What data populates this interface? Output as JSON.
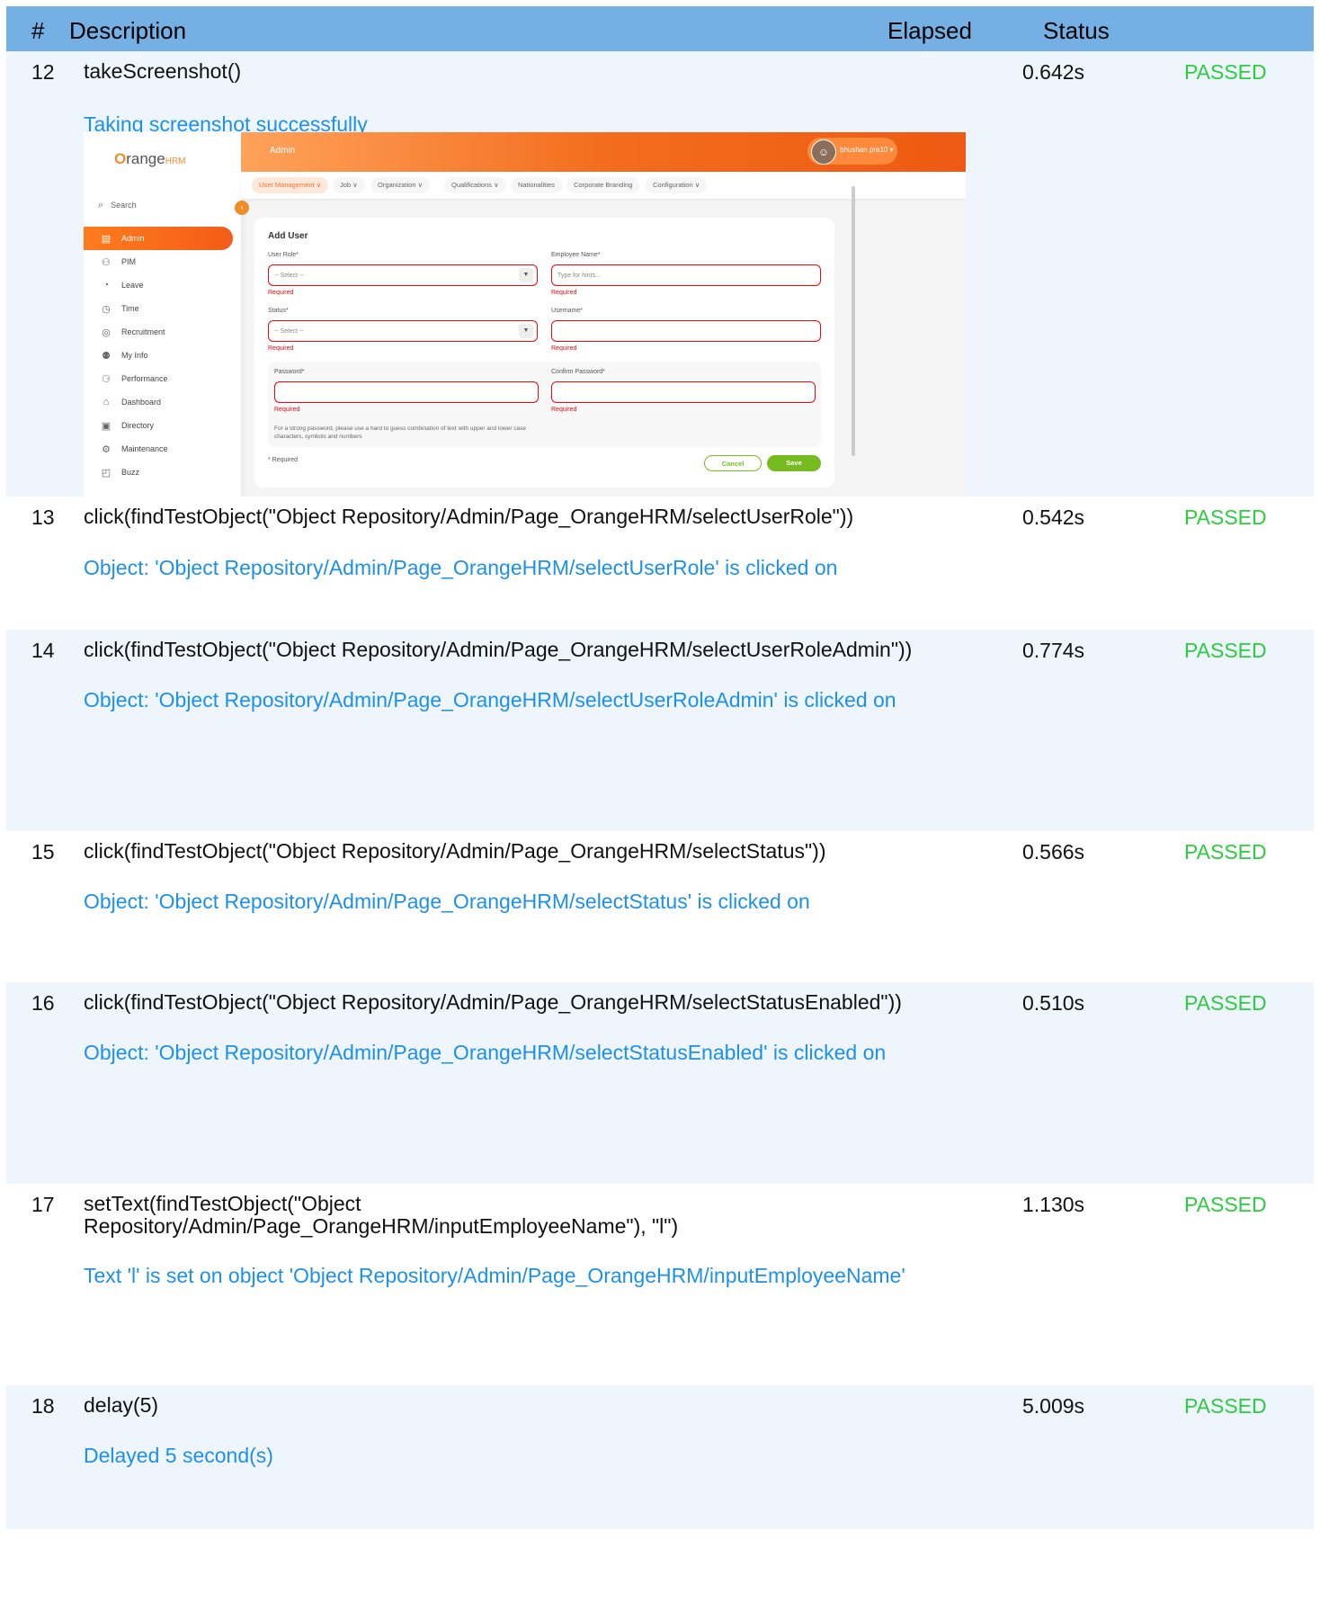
{
  "header": {
    "num": "#",
    "description": "Description",
    "elapsed": "Elapsed",
    "status": "Status"
  },
  "steps": [
    {
      "num": "12",
      "desc": "takeScreenshot()",
      "elapsed": "0.642s",
      "status": "PASSED",
      "message": "Taking screenshot successfully"
    },
    {
      "num": "13",
      "desc": "click(findTestObject(\"Object Repository/Admin/Page_OrangeHRM/selectUserRole\"))",
      "elapsed": "0.542s",
      "status": "PASSED",
      "message": "Object: 'Object Repository/Admin/Page_OrangeHRM/selectUserRole' is clicked on"
    },
    {
      "num": "14",
      "desc": "click(findTestObject(\"Object Repository/Admin/Page_OrangeHRM/selectUserRoleAdmin\"))",
      "elapsed": "0.774s",
      "status": "PASSED",
      "message": "Object: 'Object Repository/Admin/Page_OrangeHRM/selectUserRoleAdmin' is clicked on"
    },
    {
      "num": "15",
      "desc": "click(findTestObject(\"Object Repository/Admin/Page_OrangeHRM/selectStatus\"))",
      "elapsed": "0.566s",
      "status": "PASSED",
      "message": "Object: 'Object Repository/Admin/Page_OrangeHRM/selectStatus' is clicked on"
    },
    {
      "num": "16",
      "desc": "click(findTestObject(\"Object Repository/Admin/Page_OrangeHRM/selectStatusEnabled\"))",
      "elapsed": "0.510s",
      "status": "PASSED",
      "message": "Object: 'Object Repository/Admin/Page_OrangeHRM/selectStatusEnabled' is clicked on"
    },
    {
      "num": "17",
      "desc": "setText(findTestObject(\"Object Repository/Admin/Page_OrangeHRM/inputEmployeeName\"), \"l\")",
      "elapsed": "1.130s",
      "status": "PASSED",
      "message": "Text 'l' is set on object 'Object Repository/Admin/Page_OrangeHRM/inputEmployeeName'"
    },
    {
      "num": "18",
      "desc": "delay(5)",
      "elapsed": "5.009s",
      "status": "PASSED",
      "message": "Delayed 5 second(s)"
    }
  ],
  "shot": {
    "logo_main": "range",
    "logo_o": "O",
    "logo_suffix": "HRM",
    "search": "Search",
    "collapse_icon": "‹",
    "nav": [
      {
        "label": "Admin",
        "icon": "▤"
      },
      {
        "label": "PIM",
        "icon": "⚇"
      },
      {
        "label": "Leave",
        "icon": "◔"
      },
      {
        "label": "Time",
        "icon": "◷"
      },
      {
        "label": "Recruitment",
        "icon": "◎"
      },
      {
        "label": "My Info",
        "icon": "⚉"
      },
      {
        "label": "Performance",
        "icon": "⚆"
      },
      {
        "label": "Dashboard",
        "icon": "⌂"
      },
      {
        "label": "Directory",
        "icon": "▣"
      },
      {
        "label": "Maintenance",
        "icon": "⚙"
      },
      {
        "label": "Buzz",
        "icon": "◰"
      }
    ],
    "topbar_title": "Admin",
    "user_name": "bhushan pra10 ▾",
    "menu": [
      "User Management ∨",
      "Job ∨",
      "Organization ∨",
      "Qualifications ∨",
      "Nationalities",
      "Corporate Branding",
      "Configuration ∨"
    ],
    "card_title": "Add User",
    "user_role_label": "User Role*",
    "employee_name_label": "Employee Name*",
    "status_label": "Status*",
    "username_label": "Username*",
    "password_label": "Password*",
    "confirm_password_label": "Confirm Password*",
    "select_placeholder": "-- Select --",
    "employee_placeholder": "Type for hints...",
    "required": "Required",
    "hint": "For a strong password, please use a hard to guess combination of text with upper and lower case characters, symbols and numbers",
    "required_note": "* Required",
    "cancel": "Cancel",
    "save": "Save",
    "accent": "#f36d1e",
    "save_color": "#76bc21"
  }
}
